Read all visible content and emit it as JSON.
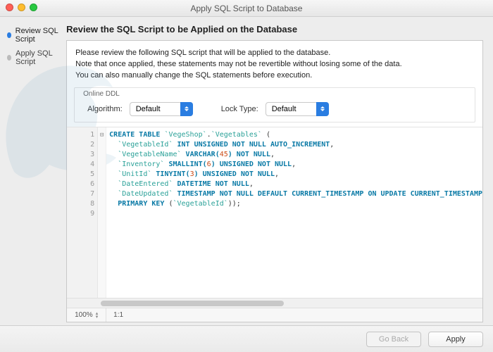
{
  "window": {
    "title": "Apply SQL Script to Database"
  },
  "sidebar": {
    "steps": [
      {
        "label": "Review SQL Script",
        "active": true
      },
      {
        "label": "Apply SQL Script",
        "active": false
      }
    ]
  },
  "main": {
    "heading": "Review the SQL Script to be Applied on the Database",
    "instructions": {
      "line1": "Please review the following SQL script that will be applied to the database.",
      "line2": "Note that once applied, these statements may not be revertible without losing some of the data.",
      "line3": "You can also manually change the SQL statements before execution."
    },
    "ddl": {
      "group_label": "Online DDL",
      "algorithm_label": "Algorithm:",
      "algorithm_value": "Default",
      "locktype_label": "Lock Type:",
      "locktype_value": "Default"
    },
    "editor": {
      "line_count": 9,
      "fold_marker": "⊟",
      "status": {
        "zoom": "100%",
        "ratio": "1:1"
      },
      "sql": {
        "l1": {
          "kw1": "CREATE TABLE",
          "id1": "`VegeShop`",
          "dot": ".",
          "id2": "`Vegetables`",
          "paren": " ("
        },
        "l2": {
          "id": "`VegetableId`",
          "ty": "INT UNSIGNED NOT NULL AUTO_INCREMENT",
          "comma": ","
        },
        "l3": {
          "id": "`VegetableName`",
          "ty1": "VARCHAR(",
          "num": "45",
          "ty2": ") NOT NULL",
          "comma": ","
        },
        "l4": {
          "id": "`Inventory`",
          "ty1": "SMALLINT(",
          "num": "6",
          "ty2": ") UNSIGNED NOT NULL",
          "comma": ","
        },
        "l5": {
          "id": "`UnitId`",
          "ty1": "TINYINT(",
          "num": "3",
          "ty2": ") UNSIGNED NOT NULL",
          "comma": ","
        },
        "l6": {
          "id": "`DateEntered`",
          "ty": "DATETIME NOT NULL",
          "comma": ","
        },
        "l7": {
          "id": "`DateUpdated`",
          "ty": "TIMESTAMP NOT NULL DEFAULT CURRENT_TIMESTAMP ON UPDATE CURRENT_TIMESTAMP"
        },
        "l8": {
          "kw": "PRIMARY KEY",
          "paren1": " (",
          "id": "`VegetableId`",
          "paren2": "));"
        }
      }
    }
  },
  "footer": {
    "back_label": "Go Back",
    "apply_label": "Apply"
  }
}
